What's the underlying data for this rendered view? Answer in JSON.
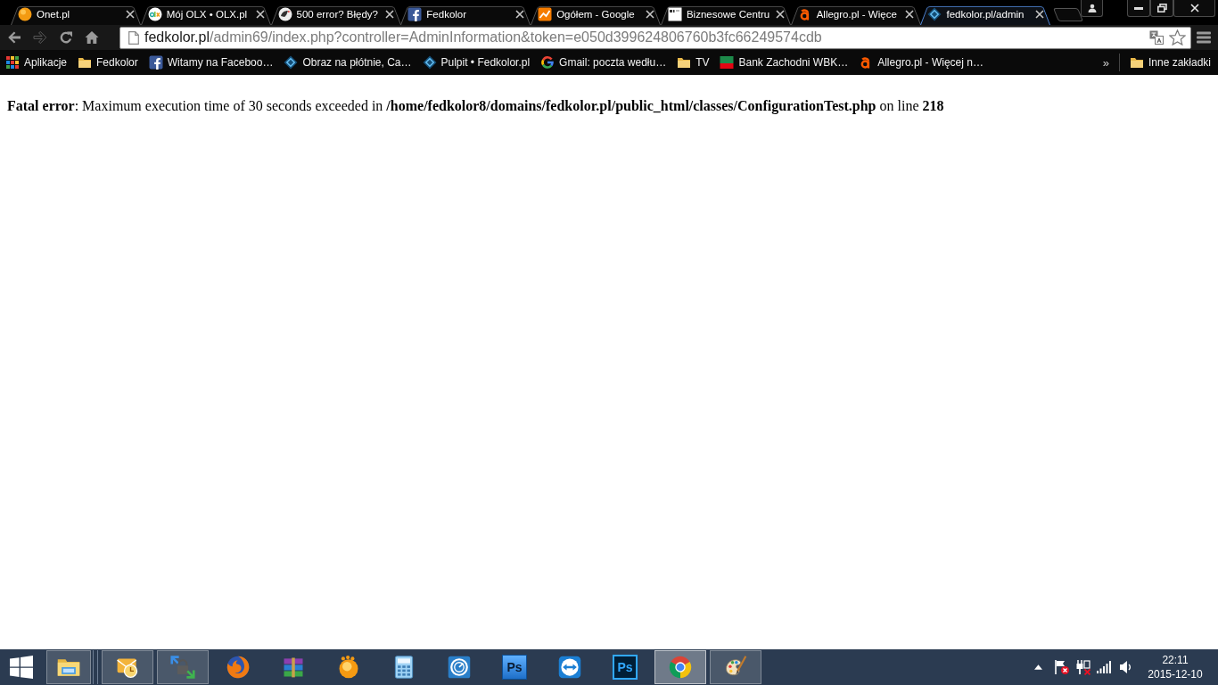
{
  "tabs": [
    {
      "title": "Onet.pl",
      "kind": "dot",
      "selected": false
    },
    {
      "title": "Mój OLX • OLX.pl",
      "kind": "olx",
      "selected": false
    },
    {
      "title": "500 error? Błędy?",
      "kind": "bird",
      "selected": false
    },
    {
      "title": "Fedkolor",
      "kind": "facebook",
      "selected": false
    },
    {
      "title": "Ogółem - Google",
      "kind": "chart",
      "selected": false
    },
    {
      "title": "Biznesowe Centru",
      "kind": "tile",
      "selected": false
    },
    {
      "title": "Allegro.pl - Więce",
      "kind": "allegro",
      "selected": false
    },
    {
      "title": "fedkolor.pl/admin",
      "kind": "diamond",
      "selected": true
    }
  ],
  "navigation": {
    "back_disabled": false,
    "forward_disabled": true
  },
  "address_bar": {
    "host": "fedkolor.pl",
    "path": "/admin69/index.php?controller=AdminInformation&token=e050d399624806760b3fc66249574cdb"
  },
  "bookmarks": [
    {
      "label": "Aplikacje",
      "kind": "apps"
    },
    {
      "label": "Fedkolor",
      "kind": "folder"
    },
    {
      "label": "Witamy na Faceboo…",
      "kind": "facebook"
    },
    {
      "label": "Obraz na płótnie, Ca…",
      "kind": "diamond"
    },
    {
      "label": "Pulpit • Fedkolor.pl",
      "kind": "diamond"
    },
    {
      "label": "Gmail: poczta wedłu…",
      "kind": "google"
    },
    {
      "label": "TV",
      "kind": "folder"
    },
    {
      "label": "Bank Zachodni WBK…",
      "kind": "flag"
    },
    {
      "label": "Allegro.pl - Więcej n…",
      "kind": "allegro"
    }
  ],
  "bookmarks_overflow": "»",
  "other_bookmarks": {
    "label": "Inne zakładki",
    "kind": "folder"
  },
  "page": {
    "error": "**Fatal error**: Maximum execution time of 30 seconds exceeded in **/home/fedkolor8/domains/fedkolor.pl/public_html/classes/ConfigurationTest.php** on line **218**"
  },
  "taskbar": {
    "apps": [
      {
        "kind": "explorer",
        "running": true,
        "active": false
      },
      {
        "kind": "outlook",
        "running": true,
        "active": false
      },
      {
        "kind": "vpn",
        "running": true,
        "active": false
      },
      {
        "kind": "firefox",
        "running": false,
        "active": false
      },
      {
        "kind": "winrar",
        "running": false,
        "active": false
      },
      {
        "kind": "player",
        "running": false,
        "active": false
      },
      {
        "kind": "calculator",
        "running": false,
        "active": false
      },
      {
        "kind": "gauge",
        "running": false,
        "active": false
      },
      {
        "kind": "photoshop",
        "label": "Ps",
        "running": false,
        "active": false
      },
      {
        "kind": "teamviewer",
        "running": false,
        "active": false
      },
      {
        "kind": "photoshopcc",
        "label": "Ps",
        "running": false,
        "active": false
      },
      {
        "kind": "chrome",
        "running": true,
        "active": true
      },
      {
        "kind": "paint",
        "running": true,
        "active": false
      }
    ],
    "clock": {
      "time": "22:11",
      "date": "2015-12-10"
    }
  }
}
